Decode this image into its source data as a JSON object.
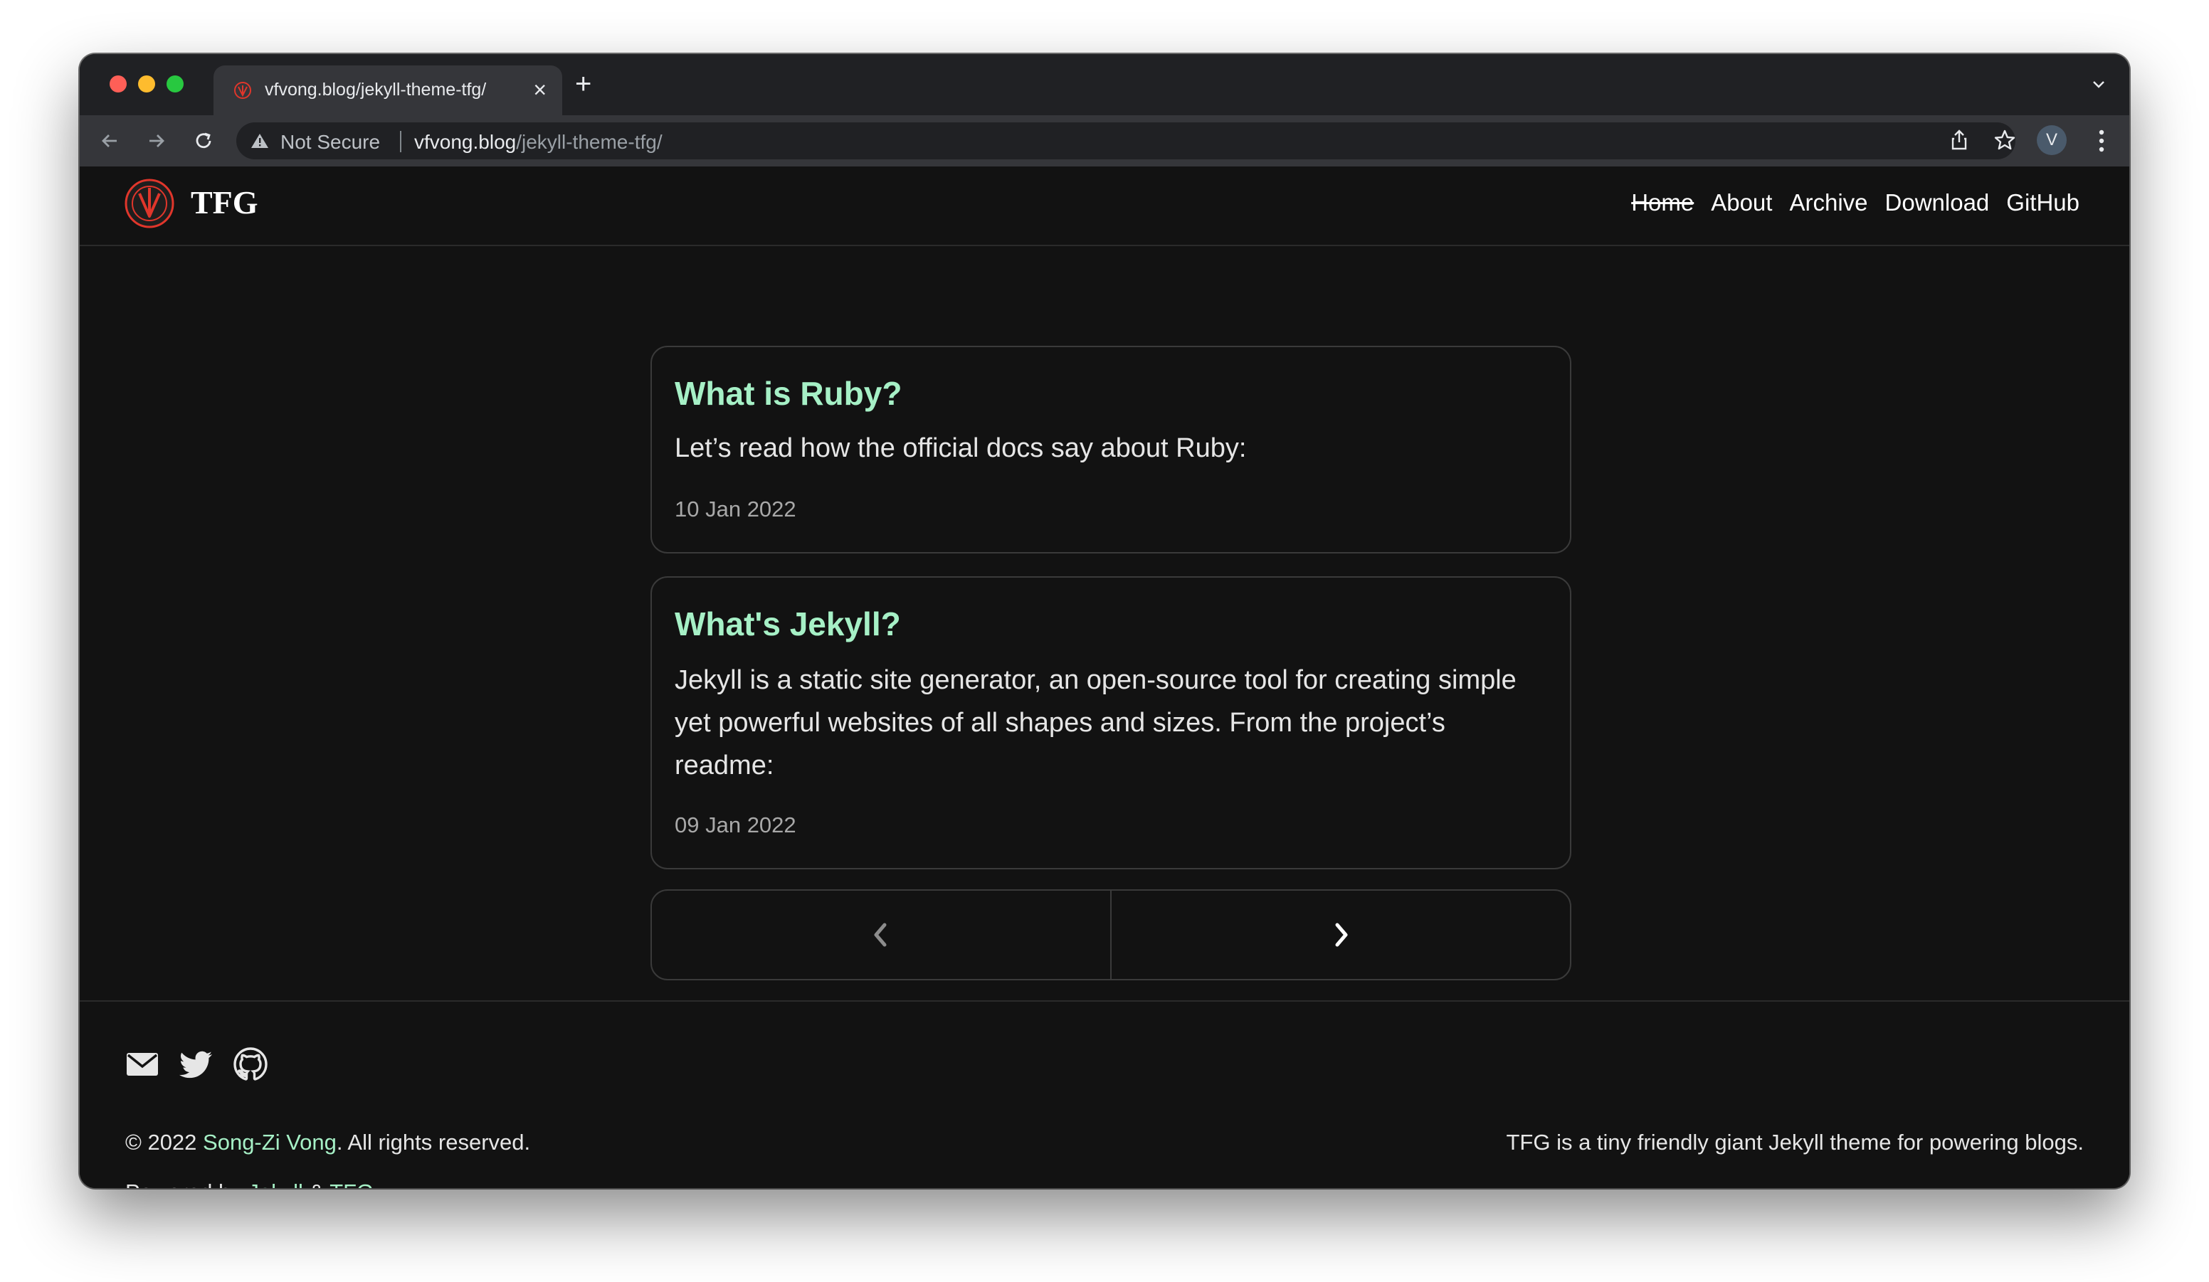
{
  "browser": {
    "tab_title": "vfvong.blog/jekyll-theme-tfg/",
    "new_tab_symbol": "+",
    "close_symbol": "×",
    "security_label": "Not Secure",
    "url_host": "vfvong.blog",
    "url_path": "/jekyll-theme-tfg/",
    "profile_initial": "V"
  },
  "site": {
    "brand": "TFG",
    "nav": [
      {
        "label": "Home"
      },
      {
        "label": "About"
      },
      {
        "label": "Archive"
      },
      {
        "label": "Download"
      },
      {
        "label": "GitHub"
      }
    ]
  },
  "posts": [
    {
      "title": "What is Ruby?",
      "excerpt": "Let’s read how the official docs say about Ruby:",
      "date": "10 Jan 2022"
    },
    {
      "title": "What's Jekyll?",
      "excerpt": "Jekyll is a static site generator, an open-source tool for creating simple yet powerful websites of all shapes and sizes. From the project’s readme:",
      "date": "09 Jan 2022"
    }
  ],
  "footer": {
    "copyright_prefix": "© 2022 ",
    "author": "Song-Zi Vong",
    "copyright_suffix": ". All rights reserved.",
    "powered_prefix": "Powered by ",
    "powered_jekyll": "Jekyll",
    "powered_amp": " & ",
    "powered_tfg": "TFG",
    "tagline": "TFG is a tiny friendly giant Jekyll theme for powering blogs."
  },
  "colors": {
    "accent": "#a6f0c6",
    "background": "#121212",
    "logo_red": "#e0362b"
  },
  "icons": {
    "social": [
      "envelope-icon",
      "twitter-icon",
      "github-icon"
    ],
    "pager": [
      "chevron-left-icon",
      "chevron-right-icon"
    ]
  }
}
